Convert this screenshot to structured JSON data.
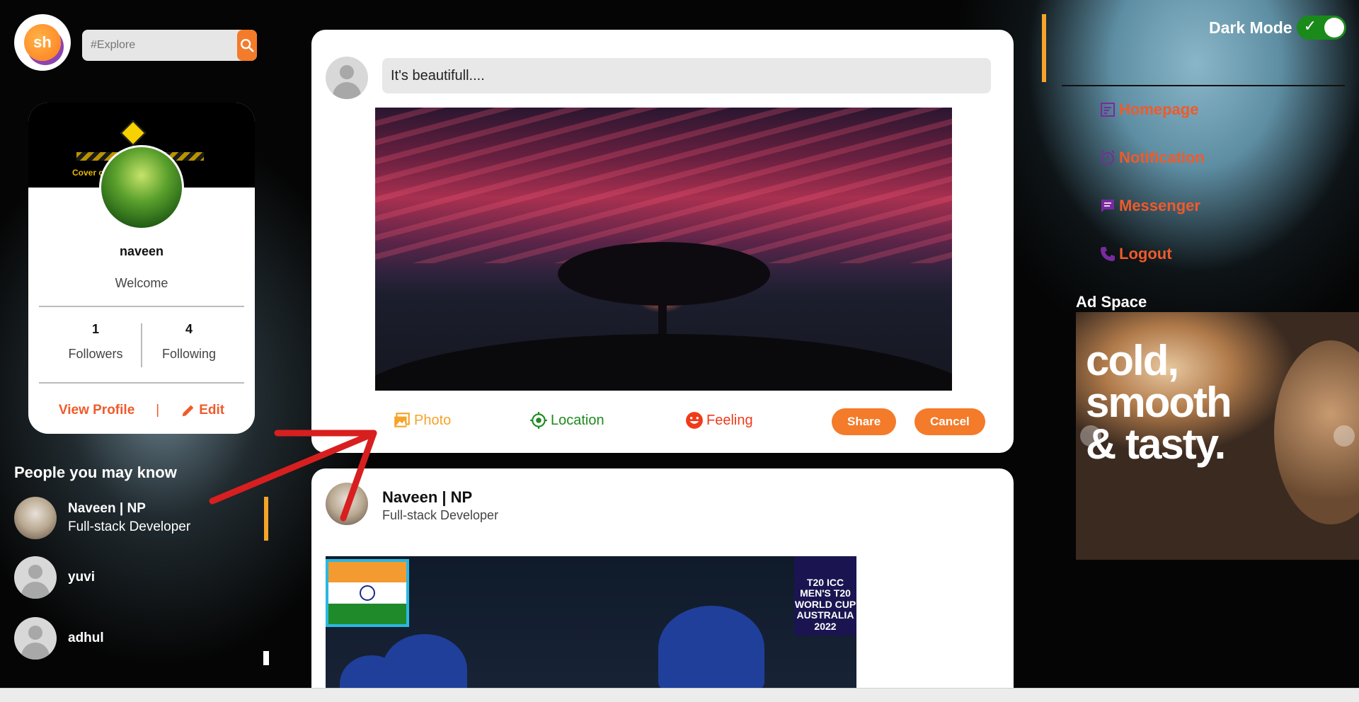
{
  "header": {
    "logo_text": "sh",
    "search_placeholder": "#Explore"
  },
  "profile": {
    "name": "naveen",
    "welcome": "Welcome",
    "cover_text": "Cover        on ...",
    "followers_count": "1",
    "followers_label": "Followers",
    "following_count": "4",
    "following_label": "Following",
    "view_profile": "View Profile",
    "separator": "|",
    "edit": "Edit"
  },
  "people_you_may_know": {
    "title": "People you may know",
    "items": [
      {
        "name": "Naveen | NP",
        "subtitle": "Full-stack Developer"
      },
      {
        "name": "yuvi",
        "subtitle": ""
      },
      {
        "name": "adhul",
        "subtitle": ""
      }
    ]
  },
  "composer": {
    "text": "It's beautifull....",
    "actions": {
      "photo": "Photo",
      "location": "Location",
      "feeling": "Feeling",
      "share": "Share",
      "cancel": "Cancel"
    }
  },
  "post": {
    "author": "Naveen | NP",
    "subtitle": "Full-stack Developer",
    "badge_text": "T20 ICC MEN'S T20 WORLD CUP AUSTRALIA 2022"
  },
  "right_nav": {
    "dark_mode_label": "Dark Mode",
    "dark_mode_on": true,
    "items": [
      {
        "label": "Homepage",
        "icon": "document-icon"
      },
      {
        "label": "Notification",
        "icon": "alarm-icon"
      },
      {
        "label": "Messenger",
        "icon": "chat-icon"
      },
      {
        "label": "Logout",
        "icon": "phone-icon"
      }
    ]
  },
  "ad": {
    "title": "Ad Space",
    "line1": "cold,",
    "line2": "smooth",
    "line3": "& tasty."
  },
  "colors": {
    "accent": "#f37b2a",
    "link": "#f05a2a",
    "toggle_on": "#1a8a1a",
    "location": "#1e8a1e",
    "photo": "#f5a32a"
  }
}
